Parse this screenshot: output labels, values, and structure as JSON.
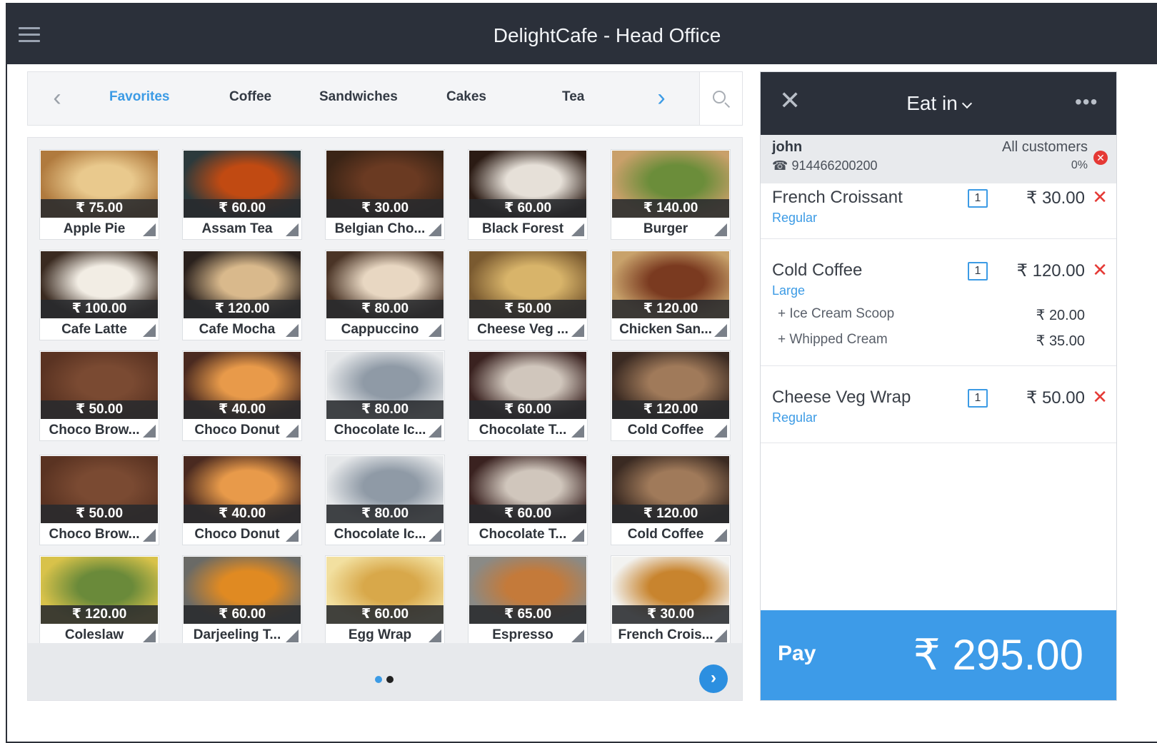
{
  "app": {
    "title": "DelightCafe - Head Office"
  },
  "icons": {
    "menu": "hamburger-icon",
    "search": "search-icon",
    "close": "close-icon",
    "more": "more-dots-icon",
    "phone": "phone-icon",
    "prev": "chevron-left-icon",
    "next": "chevron-right-icon"
  },
  "categories": {
    "prev_glyph": "‹",
    "next_glyph": "›",
    "tabs": [
      {
        "label": "Favorites",
        "active": true
      },
      {
        "label": "Coffee",
        "active": false
      },
      {
        "label": "Sandwiches",
        "active": false
      },
      {
        "label": "Cakes",
        "active": false
      },
      {
        "label": "Tea",
        "active": false
      }
    ]
  },
  "products": [
    {
      "name": "Apple Pie",
      "price": "₹ 75.00"
    },
    {
      "name": "Assam Tea",
      "price": "₹ 60.00"
    },
    {
      "name": "Belgian Cho...",
      "price": "₹ 30.00"
    },
    {
      "name": "Black Forest",
      "price": "₹ 60.00"
    },
    {
      "name": "Burger",
      "price": "₹ 140.00"
    },
    {
      "name": "Cafe Latte",
      "price": "₹ 100.00"
    },
    {
      "name": "Cafe Mocha",
      "price": "₹ 120.00"
    },
    {
      "name": "Cappuccino",
      "price": "₹ 80.00"
    },
    {
      "name": "Cheese Veg ...",
      "price": "₹ 50.00"
    },
    {
      "name": "Chicken San...",
      "price": "₹ 120.00"
    },
    {
      "name": "Choco Brow...",
      "price": "₹ 50.00"
    },
    {
      "name": "Choco Donut",
      "price": "₹ 40.00"
    },
    {
      "name": "Chocolate Ic...",
      "price": "₹ 80.00"
    },
    {
      "name": "Chocolate T...",
      "price": "₹ 60.00"
    },
    {
      "name": "Cold Coffee",
      "price": "₹ 120.00"
    },
    {
      "name": "Choco Brow...",
      "price": "₹ 50.00"
    },
    {
      "name": "Choco Donut",
      "price": "₹ 40.00"
    },
    {
      "name": "Chocolate Ic...",
      "price": "₹ 80.00"
    },
    {
      "name": "Chocolate T...",
      "price": "₹ 60.00"
    },
    {
      "name": "Cold Coffee",
      "price": "₹ 120.00"
    },
    {
      "name": "Coleslaw",
      "price": "₹ 120.00"
    },
    {
      "name": "Darjeeling T...",
      "price": "₹ 60.00"
    },
    {
      "name": "Egg Wrap",
      "price": "₹ 60.00"
    },
    {
      "name": "Espresso",
      "price": "₹ 65.00"
    },
    {
      "name": "French Crois...",
      "price": "₹ 30.00"
    }
  ],
  "pagination": {
    "pages": 2,
    "current": 1,
    "next_glyph": "›"
  },
  "order": {
    "close_glyph": "✕",
    "more_glyph": "•••",
    "mode": "Eat in",
    "customer": {
      "name": "john",
      "phone": "914466200200",
      "phone_glyph": "☎",
      "group": "All customers",
      "discount": "0%",
      "remove_glyph": "✕"
    },
    "lines": [
      {
        "name": "French Croissant",
        "variant": "Regular",
        "qty": "1",
        "price": "₹ 30.00",
        "modifiers": []
      },
      {
        "name": "Cold Coffee",
        "variant": "Large",
        "qty": "1",
        "price": "₹ 120.00",
        "modifiers": [
          {
            "name": "+ Ice Cream Scoop",
            "price": "₹ 20.00"
          },
          {
            "name": "+ Whipped Cream",
            "price": "₹ 35.00"
          }
        ]
      },
      {
        "name": "Cheese Veg Wrap",
        "variant": "Regular",
        "qty": "1",
        "price": "₹ 50.00",
        "modifiers": []
      }
    ],
    "delete_glyph": "✕",
    "pay_label": "Pay",
    "total": "₹ 295.00"
  },
  "colors": {
    "accent": "#3c9be5",
    "header": "#2b303a",
    "danger": "#e53935",
    "pay": "#3d9be8"
  }
}
